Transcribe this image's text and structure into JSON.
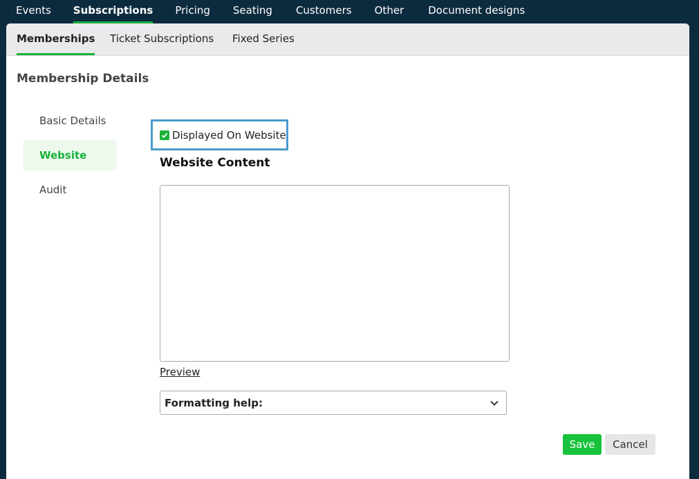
{
  "topnav": [
    {
      "label": "Events"
    },
    {
      "label": "Subscriptions",
      "active": true
    },
    {
      "label": "Pricing"
    },
    {
      "label": "Seating"
    },
    {
      "label": "Customers"
    },
    {
      "label": "Other"
    },
    {
      "label": "Document designs"
    }
  ],
  "subnav": [
    {
      "label": "Memberships",
      "active": true
    },
    {
      "label": "Ticket Subscriptions"
    },
    {
      "label": "Fixed Series"
    }
  ],
  "section_title": "Membership Details",
  "sidemenu": [
    {
      "label": "Basic Details"
    },
    {
      "label": "Website",
      "active": true
    },
    {
      "label": "Audit"
    }
  ],
  "form": {
    "displayed_checkbox_label": "Displayed On Website",
    "displayed_checked": true,
    "content_label": "Website Content",
    "content_value": "",
    "preview_link": "Preview",
    "formatting_help": "Formatting help:"
  },
  "buttons": {
    "save": "Save",
    "cancel": "Cancel"
  },
  "colors": {
    "accent": "#19b23b",
    "nav_bg": "#0d2b3e",
    "highlight_border": "#4a9acb"
  },
  "icons": {
    "checkbox": "check-icon",
    "dropdown": "chevron-down-icon"
  }
}
